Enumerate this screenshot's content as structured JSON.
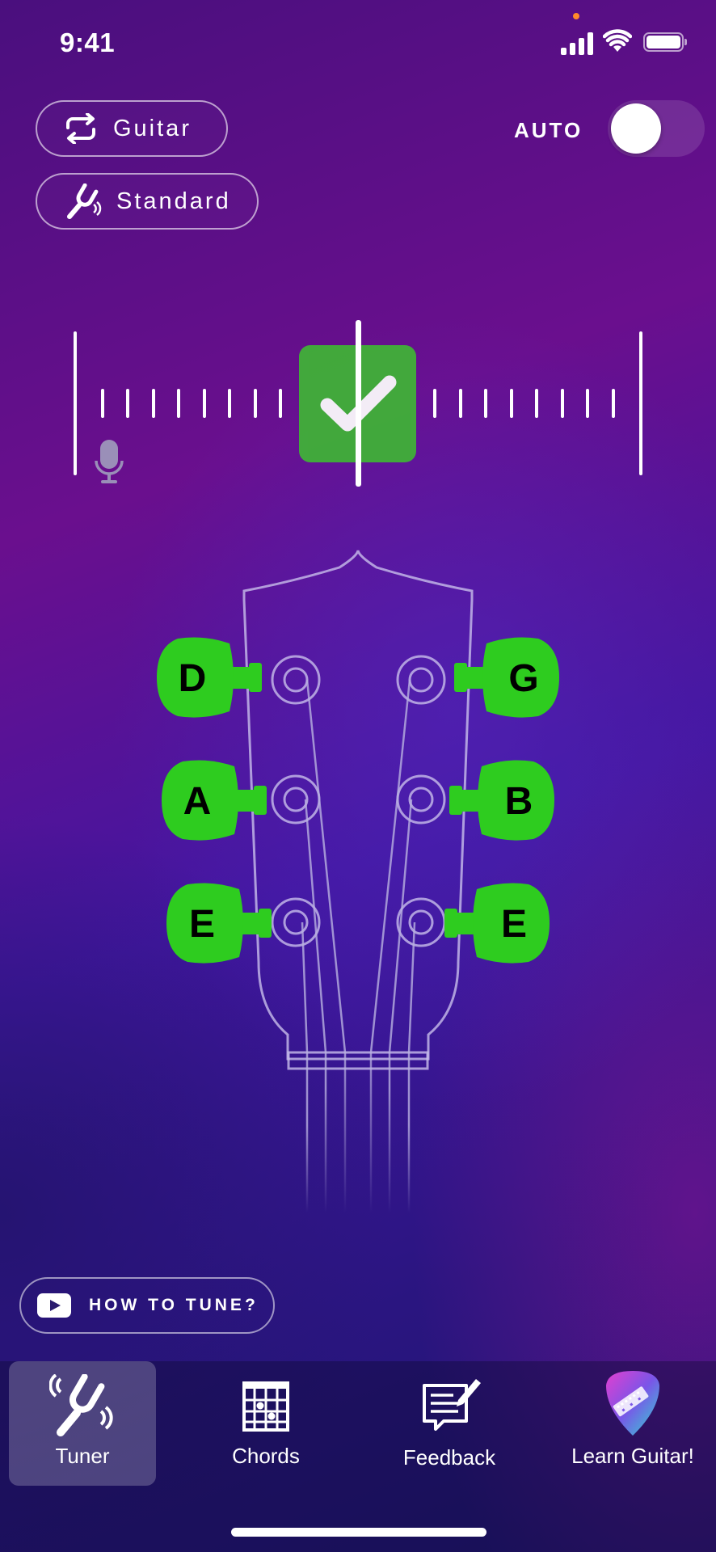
{
  "status": {
    "time": "9:41"
  },
  "instrument": {
    "label": "Guitar",
    "icon": "swap-arrows-icon"
  },
  "tuning": {
    "label": "Standard",
    "icon": "tuning-fork-icon"
  },
  "auto": {
    "label": "AUTO",
    "enabled": false
  },
  "meter": {
    "in_tune": true,
    "icon": "checkmark-icon",
    "mic_icon": "microphone-icon"
  },
  "pegs": {
    "left": [
      {
        "note": "D"
      },
      {
        "note": "A"
      },
      {
        "note": "E"
      }
    ],
    "right": [
      {
        "note": "G"
      },
      {
        "note": "B"
      },
      {
        "note": "E"
      }
    ],
    "color": "#2ecc1f",
    "tuned": true
  },
  "how_to": {
    "label": "HOW TO TUNE?",
    "icon": "play-video-icon"
  },
  "tabs": [
    {
      "label": "Tuner",
      "icon": "tuning-fork-icon",
      "active": true
    },
    {
      "label": "Chords",
      "icon": "chord-grid-icon",
      "active": false
    },
    {
      "label": "Feedback",
      "icon": "feedback-note-icon",
      "active": false
    },
    {
      "label": "Learn Guitar!",
      "icon": "guitar-pick-icon",
      "active": false
    }
  ]
}
